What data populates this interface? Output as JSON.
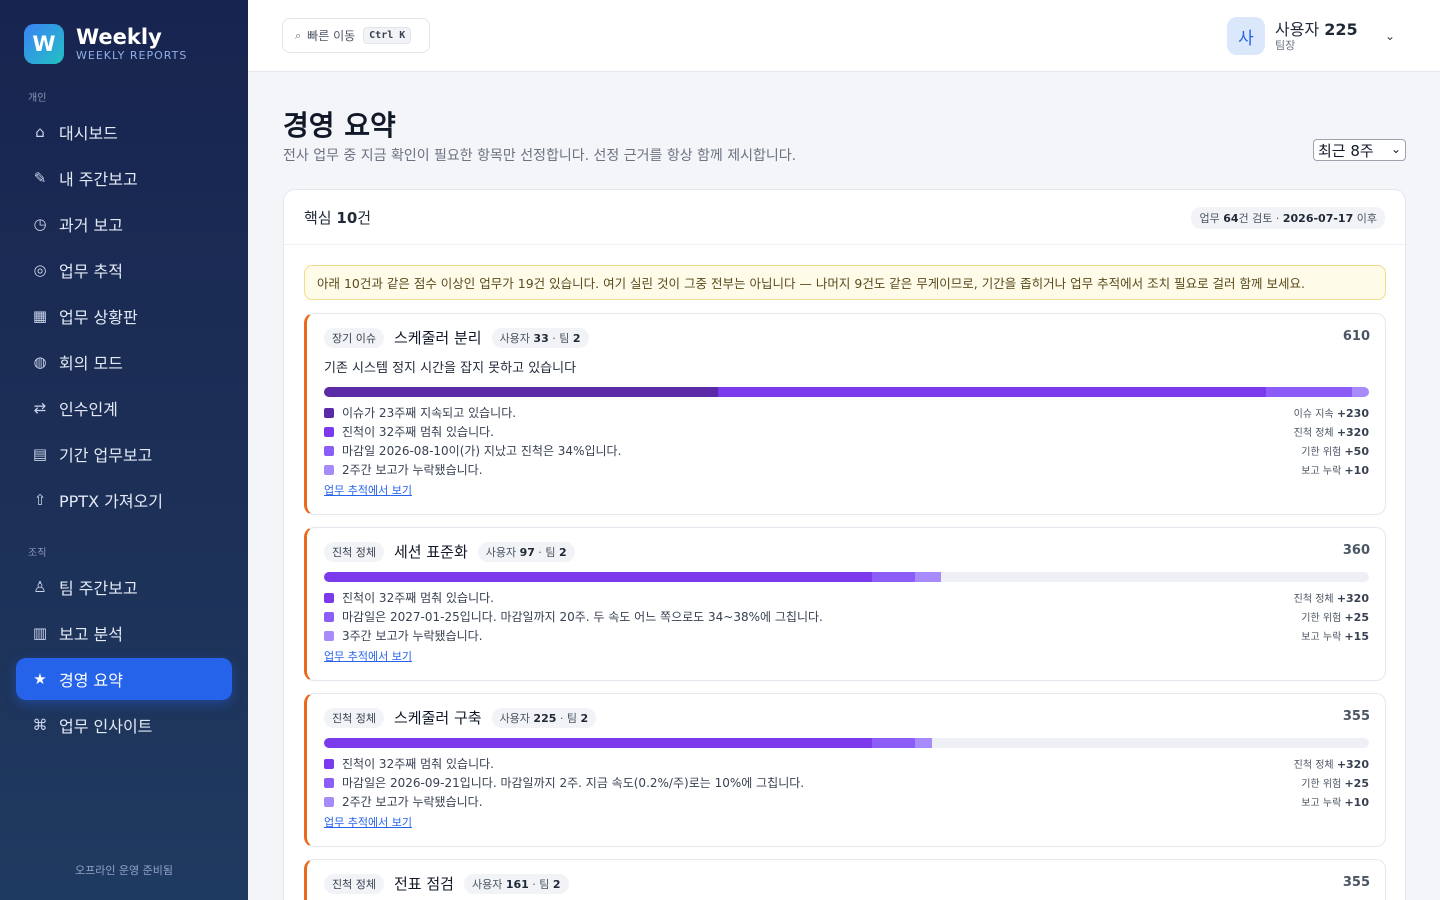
{
  "brand": {
    "logo_letter": "W",
    "title": "Weekly",
    "subtitle": "WEEKLY REPORTS"
  },
  "sidebar": {
    "section_personal": "개인",
    "section_org": "조직",
    "items": [
      {
        "label": "대시보드",
        "icon": "⌂",
        "icon_name": "home-icon"
      },
      {
        "label": "내 주간보고",
        "icon": "✎",
        "icon_name": "pencil-icon"
      },
      {
        "label": "과거 보고",
        "icon": "◷",
        "icon_name": "clock-icon"
      },
      {
        "label": "업무 추적",
        "icon": "◎",
        "icon_name": "target-icon"
      },
      {
        "label": "업무 상황판",
        "icon": "▦",
        "icon_name": "board-icon"
      },
      {
        "label": "회의 모드",
        "icon": "◍",
        "icon_name": "globe-icon"
      },
      {
        "label": "인수인계",
        "icon": "⇄",
        "icon_name": "swap-icon"
      },
      {
        "label": "기간 업무보고",
        "icon": "▤",
        "icon_name": "report-icon"
      },
      {
        "label": "PPTX 가져오기",
        "icon": "⇧",
        "icon_name": "upload-icon"
      },
      {
        "label": "팀 주간보고",
        "icon": "♙",
        "icon_name": "team-icon"
      },
      {
        "label": "보고 분석",
        "icon": "▥",
        "icon_name": "analytics-icon"
      },
      {
        "label": "경영 요약",
        "icon": "★",
        "icon_name": "star-icon"
      },
      {
        "label": "업무 인사이트",
        "icon": "⌘",
        "icon_name": "insight-icon"
      }
    ],
    "footer": "오프라인 운영 준비됨"
  },
  "header": {
    "search_label": "빠른 이동",
    "search_shortcut": "Ctrl K",
    "avatar_letter": "사",
    "user_prefix": "사용자",
    "user_number": "225",
    "user_role": "팀장"
  },
  "main": {
    "title": "경영 요약",
    "subtitle": "전사 업무 중 지금 확인이 필요한 항목만 선정합니다. 선정 근거를 항상 함께 제시합니다.",
    "period_select": "최근 8주",
    "panel_prefix": "핵심",
    "panel_count": "10",
    "panel_suffix": "건",
    "meta_prefix": "업무",
    "meta_count": "64",
    "meta_mid": "건 검토 · ",
    "meta_date": "2026-07-17",
    "meta_suffix": " 이후",
    "notice": "아래 10건과 같은 점수 이상인 업무가 19건 있습니다. 여기 실린 것이 그중 전부는 아닙니다 — 나머지 9건도 같은 무게이므로, 기간을 좁히거나 업무 추적에서 조치 필요로 걸러 함께 보세요.",
    "link_label": "업무 추적에서 보기"
  },
  "colors": {
    "issue": "#5b2aa6",
    "stall": "#7c3aed",
    "deadline": "#8b5cf6",
    "missing": "#a78bfa",
    "accent": "#ea6a1d"
  },
  "items": [
    {
      "tag": "장기 이슈",
      "title": "스케줄러 분리",
      "scope_user": "사용자 ",
      "scope_user_num": "33",
      "scope_team": " · 팀 ",
      "scope_team_num": "2",
      "score": 610,
      "desc": "기존 시스템 정지 시간을 잡지 못하고 있습니다",
      "reasons": [
        {
          "text": "이슈가 23주째 지속되고 있습니다.",
          "kind": "이슈 지속",
          "points": "+230",
          "value": 230,
          "color": "#5b2aa6"
        },
        {
          "text": "진척이 32주째 멈춰 있습니다.",
          "kind": "진척 정체",
          "points": "+320",
          "value": 320,
          "color": "#7c3aed"
        },
        {
          "text": "마감일 2026-08-10이(가) 지났고 진척은 34%입니다.",
          "kind": "기한 위험",
          "points": "+50",
          "value": 50,
          "color": "#8b5cf6"
        },
        {
          "text": "2주간 보고가 누락됐습니다.",
          "kind": "보고 누락",
          "points": "+10",
          "value": 10,
          "color": "#a78bfa"
        }
      ]
    },
    {
      "tag": "진척 정체",
      "title": "세션 표준화",
      "scope_user": "사용자 ",
      "scope_user_num": "97",
      "scope_team": " · 팀 ",
      "scope_team_num": "2",
      "score": 360,
      "desc": "",
      "reasons": [
        {
          "text": "진척이 32주째 멈춰 있습니다.",
          "kind": "진척 정체",
          "points": "+320",
          "value": 320,
          "color": "#7c3aed"
        },
        {
          "text": "마감일은 2027-01-25입니다. 마감일까지 20주. 두 속도 어느 쪽으로도 34~38%에 그칩니다.",
          "kind": "기한 위험",
          "points": "+25",
          "value": 25,
          "color": "#8b5cf6"
        },
        {
          "text": "3주간 보고가 누락됐습니다.",
          "kind": "보고 누락",
          "points": "+15",
          "value": 15,
          "color": "#a78bfa"
        }
      ]
    },
    {
      "tag": "진척 정체",
      "title": "스케줄러 구축",
      "scope_user": "사용자 ",
      "scope_user_num": "225",
      "scope_team": " · 팀 ",
      "scope_team_num": "2",
      "score": 355,
      "desc": "",
      "reasons": [
        {
          "text": "진척이 32주째 멈춰 있습니다.",
          "kind": "진척 정체",
          "points": "+320",
          "value": 320,
          "color": "#7c3aed"
        },
        {
          "text": "마감일은 2026-09-21입니다. 마감일까지 2주. 지금 속도(0.2%/주)로는 10%에 그칩니다.",
          "kind": "기한 위험",
          "points": "+25",
          "value": 25,
          "color": "#8b5cf6"
        },
        {
          "text": "2주간 보고가 누락됐습니다.",
          "kind": "보고 누락",
          "points": "+10",
          "value": 10,
          "color": "#a78bfa"
        }
      ]
    },
    {
      "tag": "진척 정체",
      "title": "전표 점검",
      "scope_user": "사용자 ",
      "scope_user_num": "161",
      "scope_team": " · 팀 ",
      "scope_team_num": "2",
      "score": 355,
      "desc": "",
      "reasons": []
    }
  ]
}
